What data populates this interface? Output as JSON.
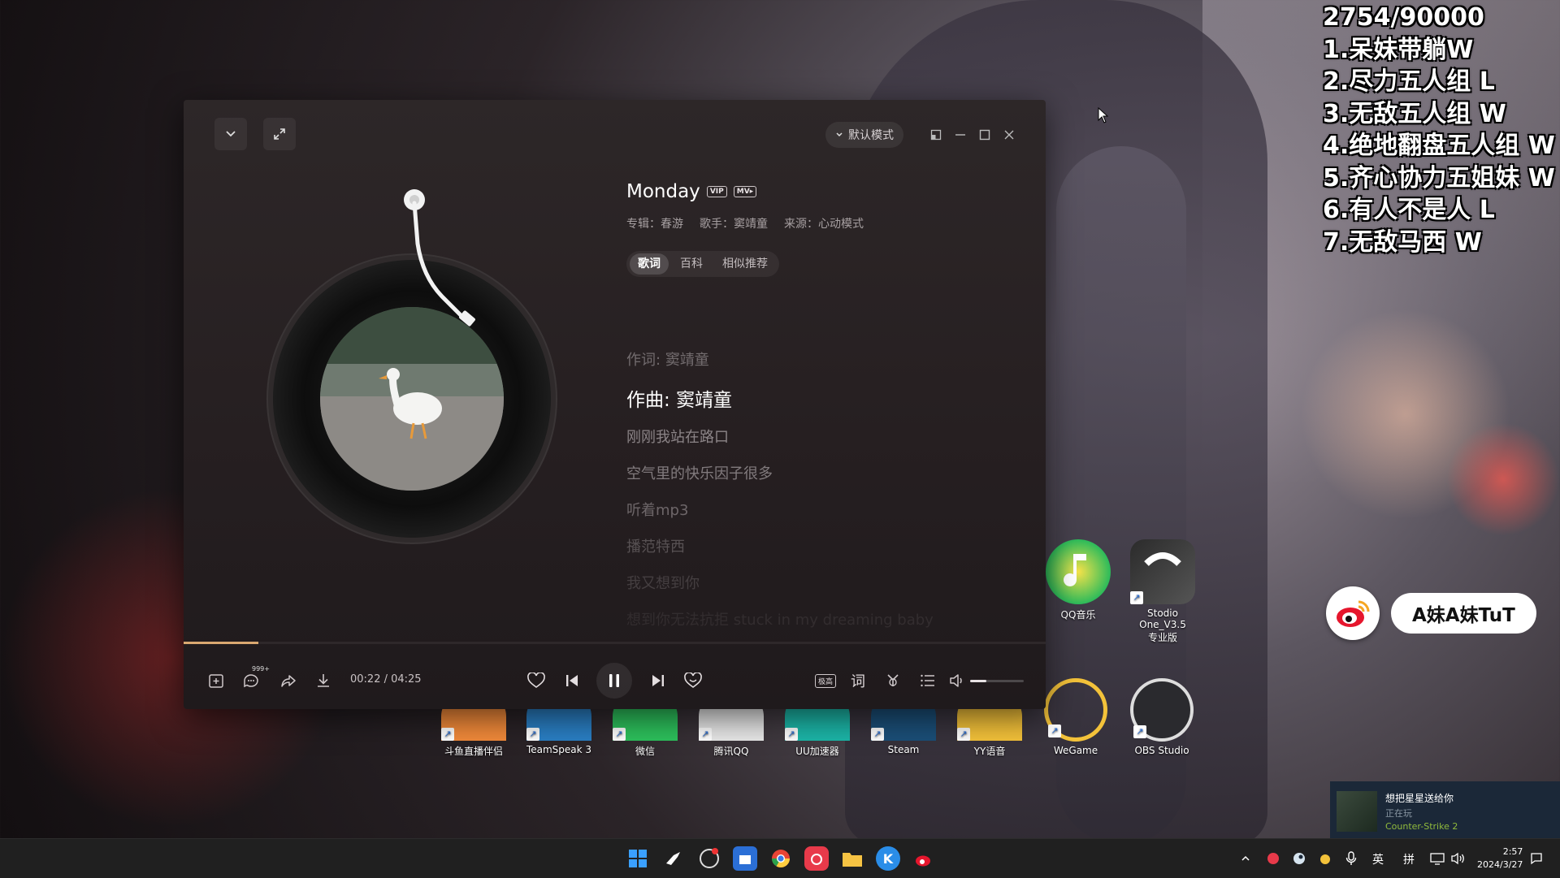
{
  "overlay": {
    "score": "2754/90000",
    "lines": [
      "1.呆妹带躺W",
      "2.尽力五人组 L",
      "3.无敌五人组 W",
      "4.绝地翻盘五人组 W",
      "5.齐心协力五姐妹 W",
      "6.有人不是人 L",
      "7.无敌马西 W"
    ]
  },
  "weibo": {
    "name": "A妹A妹TuT"
  },
  "desktop_icons": [
    {
      "label": "QQ音乐"
    },
    {
      "label": "Stodio One_V3.5",
      "sub": "专业版"
    },
    {
      "label": "斗鱼直播伴侣"
    },
    {
      "label": "TeamSpeak 3"
    },
    {
      "label": "微信"
    },
    {
      "label": "腾讯QQ"
    },
    {
      "label": "UU加速器"
    },
    {
      "label": "Steam"
    },
    {
      "label": "YY语音"
    },
    {
      "label": "WeGame"
    },
    {
      "label": "OBS Studio"
    }
  ],
  "player": {
    "mode_label": "默认模式",
    "song": {
      "title": "Monday",
      "tags": [
        "VIP",
        "MV▸"
      ],
      "album_label": "专辑：春游",
      "artist_label": "歌手：窦靖童",
      "source_label": "来源：心动模式"
    },
    "tabs": [
      {
        "label": "歌词",
        "active": true
      },
      {
        "label": "百科",
        "active": false
      },
      {
        "label": "相似推荐",
        "active": false
      }
    ],
    "lyrics": [
      "作词: 窦靖童",
      "作曲: 窦靖童",
      "刚刚我站在路口",
      "空气里的快乐因子很多",
      "听着mp3",
      "播范特西",
      "我又想到你",
      "想到你无法抗拒 stuck in my dreaming baby"
    ],
    "active_lyric_index": 1,
    "time": "00:22 / 04:25",
    "progress": 0.0865,
    "comment_count": "999+",
    "quality_label": "极高",
    "lyric_btn_label": "词",
    "volume": 0.3
  },
  "steam_notification": {
    "line1": "想把星星送给你",
    "line2": "正在玩",
    "line3": "Counter-Strike 2"
  },
  "taskbar": {
    "ime_lang": "英",
    "ime_mode": "拼",
    "time": "2:57",
    "date": "2024/3/27"
  }
}
